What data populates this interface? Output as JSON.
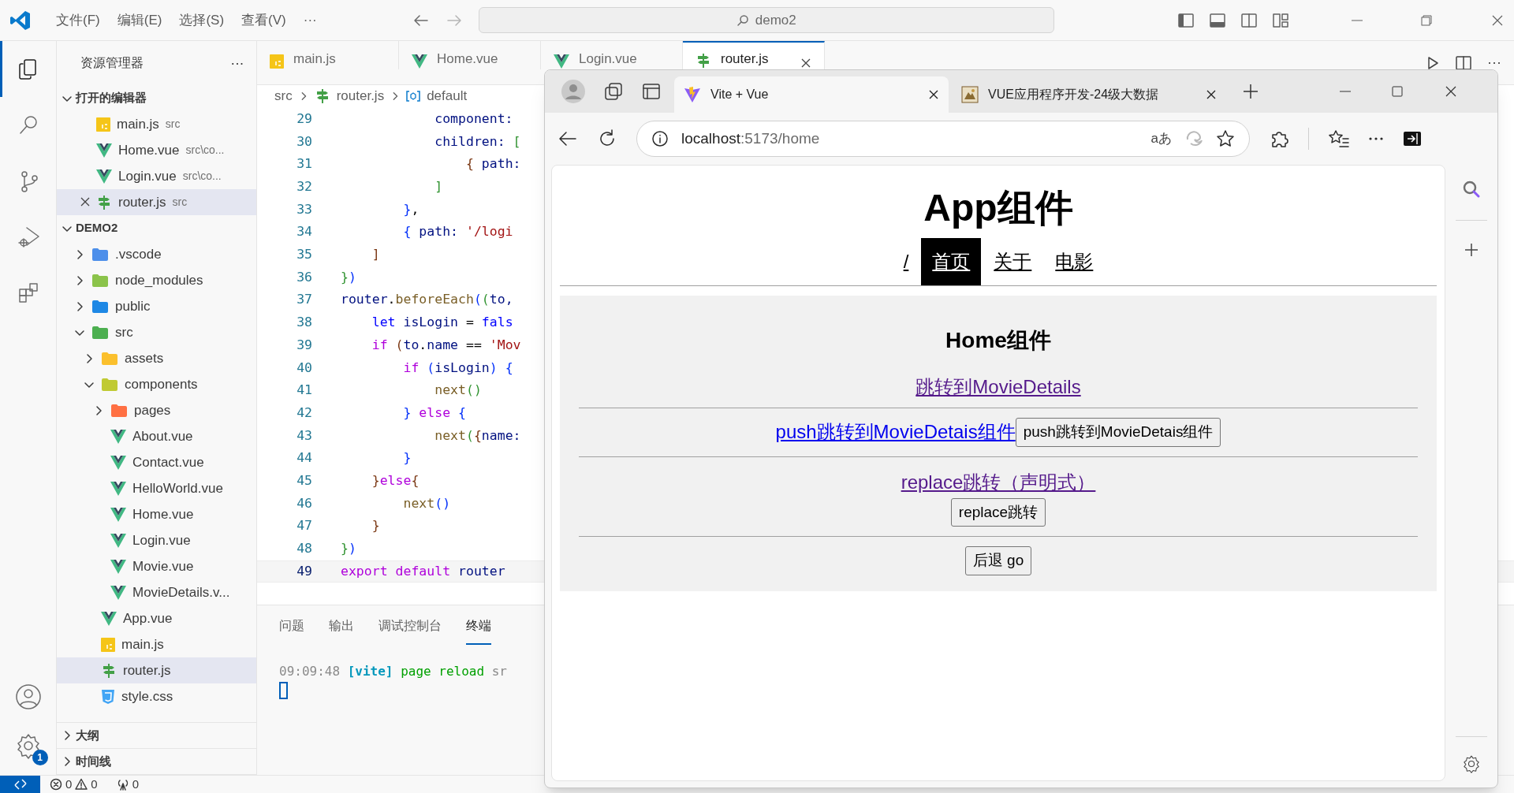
{
  "title_bar": {
    "menus": [
      "文件(F)",
      "编辑(E)",
      "选择(S)",
      "查看(V)",
      "···"
    ],
    "command_center": "demo2"
  },
  "activity_bar": [
    {
      "kind": "explorer",
      "selected": true
    },
    {
      "kind": "search",
      "selected": false
    },
    {
      "kind": "source-control",
      "selected": false
    },
    {
      "kind": "run-debug",
      "selected": false
    },
    {
      "kind": "extensions",
      "selected": false
    }
  ],
  "settings_badge": "1",
  "explorer": {
    "title": "资源管理器",
    "more": "···",
    "open_editors": {
      "title": "打开的编辑器",
      "expanded": true,
      "items": [
        {
          "name": "main.js",
          "path": "src",
          "kind": "js",
          "selected": false
        },
        {
          "name": "Home.vue",
          "path": "src\\co...",
          "kind": "vue",
          "selected": false
        },
        {
          "name": "Login.vue",
          "path": "src\\co...",
          "kind": "vue",
          "selected": false
        },
        {
          "name": "router.js",
          "path": "src",
          "kind": "router",
          "selected": true
        }
      ]
    },
    "project": {
      "title": "DEMO2",
      "expanded": true,
      "children": [
        {
          "name": ".vscode",
          "kind": "folder",
          "color": "#4d8fea",
          "expanded": false,
          "selected": false
        },
        {
          "name": "node_modules",
          "kind": "folder",
          "color": "#8bc34a",
          "expanded": false,
          "selected": false
        },
        {
          "name": "public",
          "kind": "folder",
          "color": "#1e88e5",
          "expanded": false,
          "selected": false
        },
        {
          "name": "src",
          "kind": "folder",
          "color": "#4caf50",
          "expanded": true,
          "selected": false,
          "children": [
            {
              "name": "assets",
              "kind": "folder",
              "color": "#fbc02d",
              "expanded": false,
              "selected": false
            },
            {
              "name": "components",
              "kind": "folder",
              "color": "#c0ca33",
              "expanded": true,
              "selected": false,
              "children": [
                {
                  "name": "pages",
                  "kind": "folder",
                  "color": "#ff7043",
                  "expanded": false,
                  "selected": false
                },
                {
                  "name": "About.vue",
                  "kind": "vue",
                  "selected": false
                },
                {
                  "name": "Contact.vue",
                  "kind": "vue",
                  "selected": false
                },
                {
                  "name": "HelloWorld.vue",
                  "kind": "vue",
                  "selected": false
                },
                {
                  "name": "Home.vue",
                  "kind": "vue",
                  "selected": false
                },
                {
                  "name": "Login.vue",
                  "kind": "vue",
                  "selected": false
                },
                {
                  "name": "Movie.vue",
                  "kind": "vue",
                  "selected": false
                },
                {
                  "name": "MovieDetails.v...",
                  "kind": "vue",
                  "selected": false
                }
              ]
            },
            {
              "name": "App.vue",
              "kind": "vue",
              "selected": false
            },
            {
              "name": "main.js",
              "kind": "js",
              "selected": false
            },
            {
              "name": "router.js",
              "kind": "router",
              "selected": true
            },
            {
              "name": "style.css",
              "kind": "css",
              "selected": false
            }
          ]
        }
      ]
    },
    "sections": [
      {
        "title": "大纲",
        "expanded": false
      },
      {
        "title": "时间线",
        "expanded": false
      }
    ]
  },
  "editor_tabs": [
    {
      "label": "main.js",
      "kind": "js",
      "selected": false
    },
    {
      "label": "Home.vue",
      "kind": "vue",
      "selected": false
    },
    {
      "label": "Login.vue",
      "kind": "vue",
      "selected": false
    },
    {
      "label": "router.js",
      "kind": "router",
      "selected": true
    }
  ],
  "editor_more": "···",
  "breadcrumb": [
    "src",
    "router.js",
    "default"
  ],
  "code": [
    {
      "number": "29",
      "active": false,
      "tokens": [
        {
          "text": "            component:",
          "kind": "var"
        }
      ]
    },
    {
      "number": "30",
      "active": false,
      "tokens": [
        {
          "text": "            children: ",
          "kind": "var"
        },
        {
          "text": "[",
          "kind": "b2"
        }
      ]
    },
    {
      "number": "31",
      "active": false,
      "tokens": [
        {
          "text": "                {",
          "kind": "b3"
        },
        {
          "text": " path:",
          "kind": "var"
        }
      ]
    },
    {
      "number": "32",
      "active": false,
      "tokens": [
        {
          "text": "            ]",
          "kind": "b2"
        }
      ]
    },
    {
      "number": "33",
      "active": false,
      "tokens": [
        {
          "text": "        }",
          "kind": "b1"
        },
        {
          "text": ",",
          "kind": "plain"
        }
      ]
    },
    {
      "number": "34",
      "active": false,
      "tokens": [
        {
          "text": "        {",
          "kind": "b1"
        },
        {
          "text": " path: ",
          "kind": "var"
        },
        {
          "text": "'/logi",
          "kind": "str"
        }
      ]
    },
    {
      "number": "35",
      "active": false,
      "tokens": [
        {
          "text": "    ]",
          "kind": "b3"
        }
      ]
    },
    {
      "number": "36",
      "active": false,
      "tokens": [
        {
          "text": "}",
          "kind": "b2"
        },
        {
          "text": ")",
          "kind": "b1"
        }
      ]
    },
    {
      "number": "37",
      "active": false,
      "tokens": [
        {
          "text": "router",
          "kind": "var"
        },
        {
          "text": ".",
          "kind": "plain"
        },
        {
          "text": "beforeEach",
          "kind": "func"
        },
        {
          "text": "(",
          "kind": "b1"
        },
        {
          "text": "(",
          "kind": "b2"
        },
        {
          "text": "to,",
          "kind": "var"
        }
      ]
    },
    {
      "number": "38",
      "active": false,
      "tokens": [
        {
          "text": "    let",
          "kind": "storage"
        },
        {
          "text": " isLogin",
          "kind": "var"
        },
        {
          "text": " = ",
          "kind": "plain"
        },
        {
          "text": "fals",
          "kind": "storage"
        }
      ]
    },
    {
      "number": "39",
      "active": false,
      "tokens": [
        {
          "text": "    if",
          "kind": "kw"
        },
        {
          "text": " (",
          "kind": "b3"
        },
        {
          "text": "to",
          "kind": "var"
        },
        {
          "text": ".",
          "kind": "plain"
        },
        {
          "text": "name",
          "kind": "var"
        },
        {
          "text": " == ",
          "kind": "plain"
        },
        {
          "text": "'Mov",
          "kind": "str"
        }
      ]
    },
    {
      "number": "40",
      "active": false,
      "tokens": [
        {
          "text": "        if",
          "kind": "kw"
        },
        {
          "text": " (",
          "kind": "b1"
        },
        {
          "text": "isLogin",
          "kind": "var"
        },
        {
          "text": ")",
          "kind": "b1"
        },
        {
          "text": " {",
          "kind": "b1"
        }
      ]
    },
    {
      "number": "41",
      "active": false,
      "tokens": [
        {
          "text": "            next",
          "kind": "func"
        },
        {
          "text": "()",
          "kind": "b2"
        }
      ]
    },
    {
      "number": "42",
      "active": false,
      "tokens": [
        {
          "text": "        }",
          "kind": "b1"
        },
        {
          "text": " else",
          "kind": "kw"
        },
        {
          "text": " {",
          "kind": "b1"
        }
      ]
    },
    {
      "number": "43",
      "active": false,
      "tokens": [
        {
          "text": "            next",
          "kind": "func"
        },
        {
          "text": "(",
          "kind": "b2"
        },
        {
          "text": "{",
          "kind": "b3"
        },
        {
          "text": "name:",
          "kind": "var"
        }
      ]
    },
    {
      "number": "44",
      "active": false,
      "tokens": [
        {
          "text": "        }",
          "kind": "b1"
        }
      ]
    },
    {
      "number": "45",
      "active": false,
      "tokens": [
        {
          "text": "    }",
          "kind": "b3"
        },
        {
          "text": "else",
          "kind": "kw"
        },
        {
          "text": "{",
          "kind": "b3"
        }
      ]
    },
    {
      "number": "46",
      "active": false,
      "tokens": [
        {
          "text": "        next",
          "kind": "func"
        },
        {
          "text": "()",
          "kind": "b1"
        }
      ]
    },
    {
      "number": "47",
      "active": false,
      "tokens": [
        {
          "text": "    }",
          "kind": "b3"
        }
      ]
    },
    {
      "number": "48",
      "active": false,
      "tokens": [
        {
          "text": "}",
          "kind": "b2"
        },
        {
          "text": ")",
          "kind": "b1"
        }
      ]
    },
    {
      "number": "49",
      "active": true,
      "tokens": [
        {
          "text": "export",
          "kind": "kw"
        },
        {
          "text": " default",
          "kind": "kw"
        },
        {
          "text": " router",
          "kind": "var"
        }
      ]
    }
  ],
  "panel": {
    "tabs": [
      {
        "label": "问题",
        "selected": false
      },
      {
        "label": "输出",
        "selected": false
      },
      {
        "label": "调试控制台",
        "selected": false
      },
      {
        "label": "终端",
        "selected": true
      }
    ],
    "terminal": [
      {
        "text": "09:09:48",
        "kind": "time"
      },
      {
        "text": " [vite]",
        "kind": "tag"
      },
      {
        "text": " page reload",
        "kind": "msg"
      },
      {
        "text": " sr",
        "kind": "time"
      }
    ]
  },
  "status_bar": {
    "errors": "0",
    "warnings": "0",
    "ports": "0"
  },
  "browser": {
    "tabs": [
      {
        "title": "Vite + Vue",
        "kind": "vite",
        "selected": true
      },
      {
        "title": "VUE应用程序开发-24级大数据",
        "kind": "course",
        "selected": false
      }
    ],
    "address": {
      "host": "localhost",
      "rest": ":5173/home"
    },
    "read_aloud": "aあ",
    "page": {
      "title": "App组件",
      "nav": [
        {
          "label": "/",
          "selected": false
        },
        {
          "label": "首页",
          "selected": true
        },
        {
          "label": "关于",
          "selected": false
        },
        {
          "label": "电影",
          "selected": false
        }
      ],
      "home": {
        "title": "Home组件",
        "blocks": [
          {
            "kind": "link",
            "text": "跳转到MovieDetails",
            "visited": true
          },
          {
            "kind": "rule"
          },
          {
            "kind": "link_button",
            "text": "push跳转到MovieDetais组件",
            "visited": false,
            "button": "push跳转到MovieDetais组件"
          },
          {
            "kind": "rule"
          },
          {
            "kind": "link_stack",
            "text": "replace跳转（声明式）",
            "visited": true,
            "button": "replace跳转"
          },
          {
            "kind": "rule"
          },
          {
            "kind": "button",
            "button": "后退 go"
          }
        ]
      }
    }
  }
}
